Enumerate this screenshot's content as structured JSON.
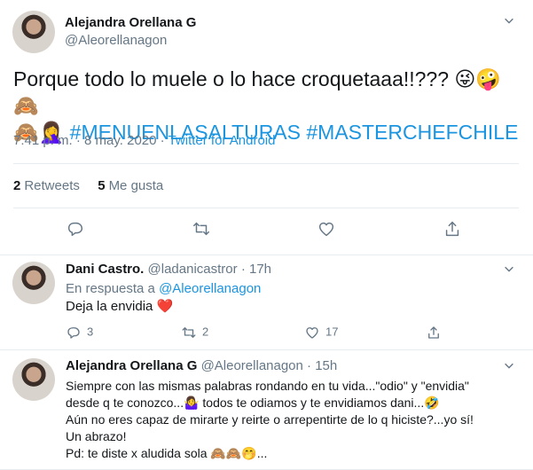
{
  "tweet": {
    "author_name": "Alejandra Orellana G",
    "author_handle": "@Aleorellanagon",
    "text_before": "Porque todo lo muele o lo hace croquetaaa!!??? 😜🤪🙈",
    "text_line2_emojis": "🙈🤦‍♀️",
    "hashtag1": "#MENUENLASALTURAS",
    "hashtag2": "#MASTERCHEFCHILE",
    "time": "7:41 p. m.",
    "separator": "·",
    "date": "8 may. 2020",
    "source": "Twitter for Android",
    "retweets_count": "2",
    "retweets_label": "Retweets",
    "likes_count": "5",
    "likes_label": "Me gusta"
  },
  "replies": [
    {
      "author_name": "Dani Castro.",
      "author_handle": "@ladanicastror",
      "time": "17h",
      "in_reply_prefix": "En respuesta a",
      "in_reply_handle": "@Aleorellanagon",
      "text": "Deja la envidia ❤️",
      "reply_count": "3",
      "retweet_count": "2",
      "like_count": "17"
    },
    {
      "author_name": "Alejandra Orellana G",
      "author_handle": "@Aleorellanagon",
      "time": "15h",
      "line1": "Siempre con las mismas palabras rondando en tu vida...\"odio\" y \"envidia\"",
      "line2": "desde q te conozco...🤷‍♀️ todos te odiamos y te envidiamos dani...🤣",
      "line3": "Aún no eres capaz de mirarte y reirte o arrepentirte de lo q hiciste?...yo sí!",
      "line4": "Un abrazo!",
      "line5": "Pd: te diste x aludida sola 🙈🙈🤭..."
    }
  ],
  "icons": {
    "more": "chevron-down-icon",
    "reply": "reply-icon",
    "retweet": "retweet-icon",
    "like": "heart-icon",
    "share": "share-icon"
  },
  "colors": {
    "link": "#1b95e0",
    "muted": "#657786",
    "text": "#14171a",
    "divider": "#e6ecf0"
  }
}
